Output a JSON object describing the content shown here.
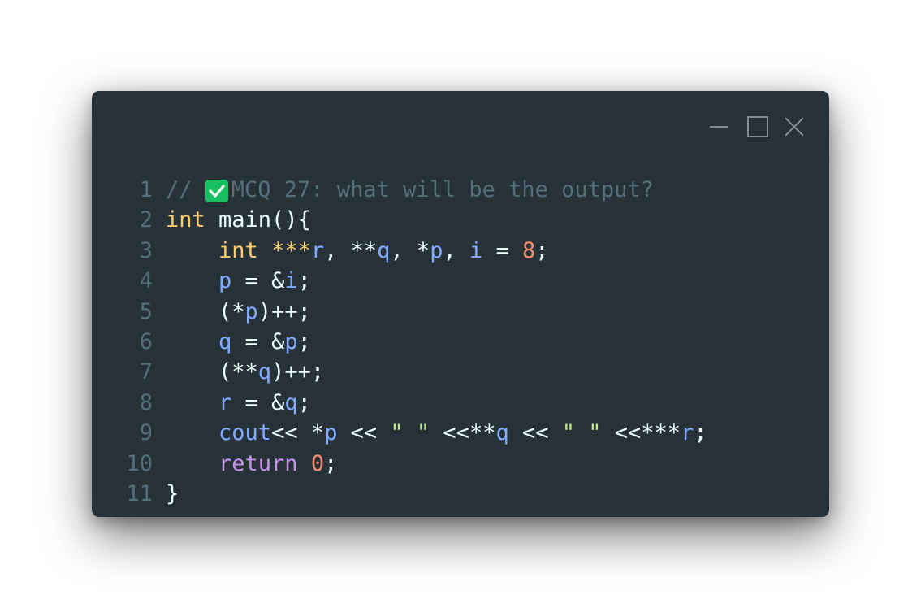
{
  "window": {
    "controls": {
      "minimize_icon": "minimize-icon",
      "maximize_icon": "maximize-icon",
      "close_icon": "close-icon"
    }
  },
  "code": {
    "lines": [
      {
        "n": "1",
        "tokens": [
          {
            "t": "// ",
            "c": "comment"
          },
          {
            "icon": "check-mark-icon"
          },
          {
            "t": "MCQ 27: what will be the output?",
            "c": "comment"
          }
        ]
      },
      {
        "n": "2",
        "tokens": [
          {
            "t": "int",
            "c": "keyword"
          },
          {
            "t": " main(){",
            "c": "plain"
          }
        ]
      },
      {
        "n": "3",
        "tokens": [
          {
            "t": "    ",
            "c": "plain"
          },
          {
            "t": "int",
            "c": "keyword"
          },
          {
            "t": " ",
            "c": "plain"
          },
          {
            "t": "***",
            "c": "ptr"
          },
          {
            "t": "r",
            "c": "var"
          },
          {
            "t": ", **",
            "c": "op"
          },
          {
            "t": "q",
            "c": "var"
          },
          {
            "t": ", *",
            "c": "op"
          },
          {
            "t": "p",
            "c": "var"
          },
          {
            "t": ", ",
            "c": "op"
          },
          {
            "t": "i",
            "c": "var"
          },
          {
            "t": " = ",
            "c": "op"
          },
          {
            "t": "8",
            "c": "num"
          },
          {
            "t": ";",
            "c": "op"
          }
        ]
      },
      {
        "n": "4",
        "tokens": [
          {
            "t": "    ",
            "c": "plain"
          },
          {
            "t": "p",
            "c": "var"
          },
          {
            "t": " = &",
            "c": "op"
          },
          {
            "t": "i",
            "c": "var"
          },
          {
            "t": ";",
            "c": "op"
          }
        ]
      },
      {
        "n": "5",
        "tokens": [
          {
            "t": "    (*",
            "c": "op"
          },
          {
            "t": "p",
            "c": "var"
          },
          {
            "t": ")++;",
            "c": "op"
          }
        ]
      },
      {
        "n": "6",
        "tokens": [
          {
            "t": "    ",
            "c": "plain"
          },
          {
            "t": "q",
            "c": "var"
          },
          {
            "t": " = &",
            "c": "op"
          },
          {
            "t": "p",
            "c": "var"
          },
          {
            "t": ";",
            "c": "op"
          }
        ]
      },
      {
        "n": "7",
        "tokens": [
          {
            "t": "    (**",
            "c": "op"
          },
          {
            "t": "q",
            "c": "var"
          },
          {
            "t": ")++;",
            "c": "op"
          }
        ]
      },
      {
        "n": "8",
        "tokens": [
          {
            "t": "    ",
            "c": "plain"
          },
          {
            "t": "r",
            "c": "var"
          },
          {
            "t": " = &",
            "c": "op"
          },
          {
            "t": "q",
            "c": "var"
          },
          {
            "t": ";",
            "c": "op"
          }
        ]
      },
      {
        "n": "9",
        "tokens": [
          {
            "t": "    ",
            "c": "plain"
          },
          {
            "t": "cout",
            "c": "var"
          },
          {
            "t": "<< *",
            "c": "op"
          },
          {
            "t": "p",
            "c": "var"
          },
          {
            "t": " << ",
            "c": "op"
          },
          {
            "t": "\" \"",
            "c": "str"
          },
          {
            "t": " <<**",
            "c": "op"
          },
          {
            "t": "q",
            "c": "var"
          },
          {
            "t": " << ",
            "c": "op"
          },
          {
            "t": "\" \"",
            "c": "str"
          },
          {
            "t": " <<***",
            "c": "op"
          },
          {
            "t": "r",
            "c": "var"
          },
          {
            "t": ";",
            "c": "op"
          }
        ]
      },
      {
        "n": "10",
        "tokens": [
          {
            "t": "    ",
            "c": "plain"
          },
          {
            "t": "return",
            "c": "return"
          },
          {
            "t": " ",
            "c": "plain"
          },
          {
            "t": "0",
            "c": "num"
          },
          {
            "t": ";",
            "c": "op"
          }
        ]
      },
      {
        "n": "11",
        "tokens": [
          {
            "t": "}",
            "c": "plain"
          }
        ]
      }
    ]
  },
  "colors": {
    "background": "#263238",
    "comment": "#546e7a",
    "keyword": "#ffcb6b",
    "variable": "#82aaff",
    "number": "#f78c6c",
    "string": "#c3e88d",
    "return": "#c792ea",
    "check_badge": "#16c060"
  }
}
